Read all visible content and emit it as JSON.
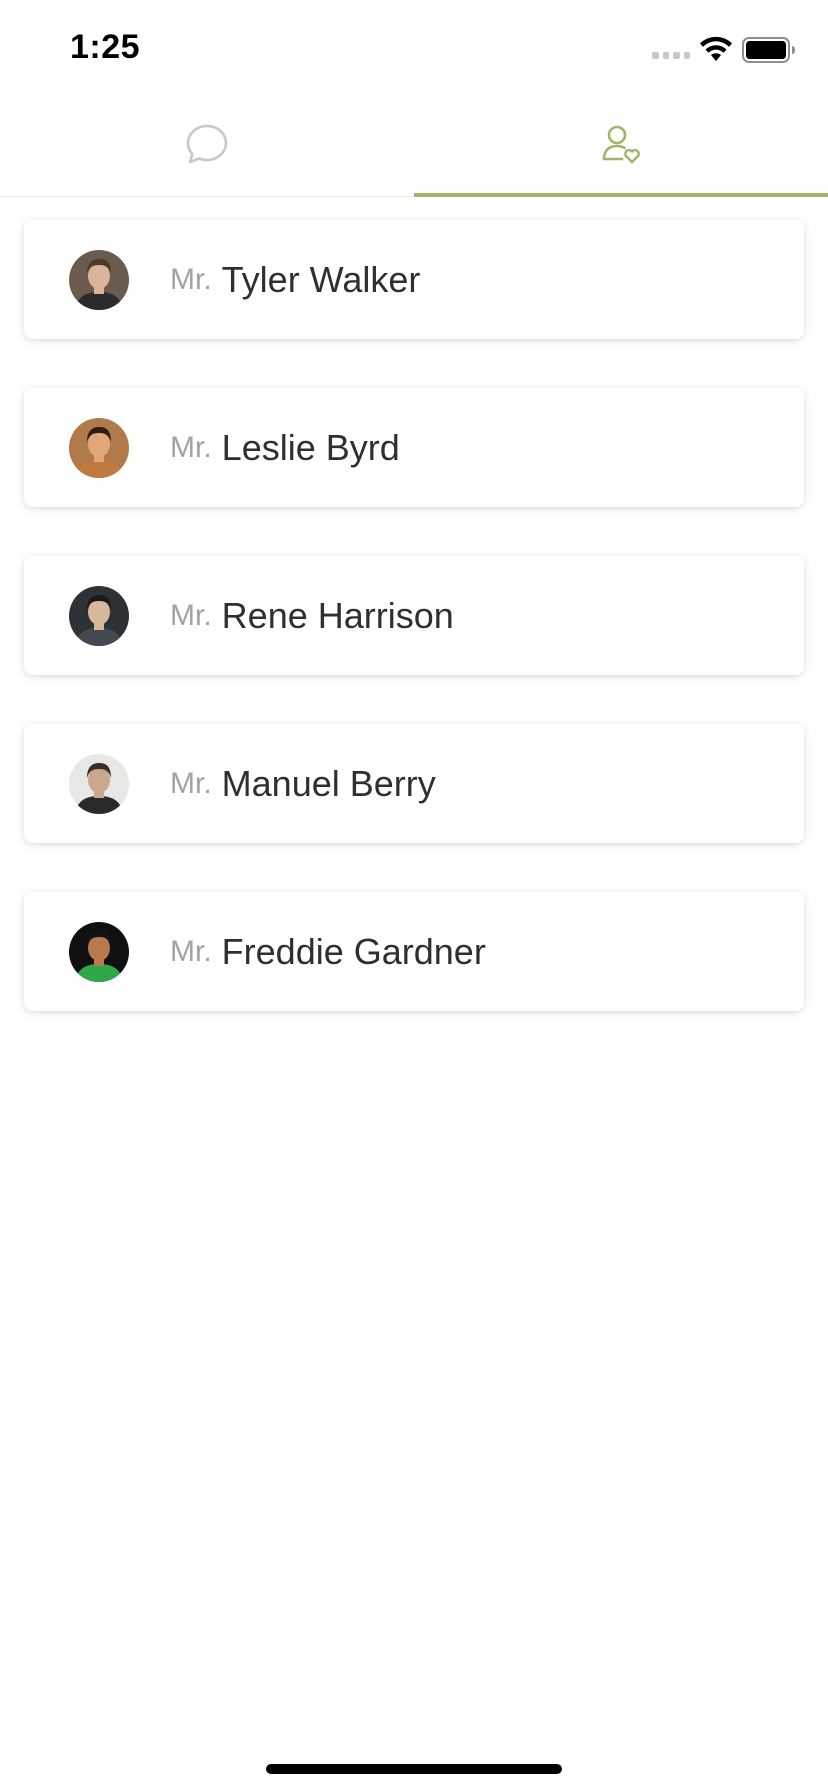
{
  "status_bar": {
    "time": "1:25"
  },
  "tabs": [
    {
      "icon": "chat-bubble-icon",
      "active": false
    },
    {
      "icon": "user-heart-icon",
      "active": true
    }
  ],
  "colors": {
    "accent": "#a0b46a",
    "inactive_icon": "#c7c7cc",
    "title_text": "#a3a3a3",
    "name_text": "#2f2f2f"
  },
  "contacts": [
    {
      "title": "Mr.",
      "name": "Tyler Walker",
      "avatar_bg": "#6b5b4e",
      "skin": "#d9b49a",
      "hair": "#4a3a2e",
      "shirt": "#2b2b2b"
    },
    {
      "title": "Mr.",
      "name": "Leslie Byrd",
      "avatar_bg": "#b07a4a",
      "skin": "#e0a878",
      "hair": "#2a1e16",
      "shirt": "#c07a3e"
    },
    {
      "title": "Mr.",
      "name": "Rene Harrison",
      "avatar_bg": "#2d3236",
      "skin": "#d8b89a",
      "hair": "#1a1a1a",
      "shirt": "#444a50"
    },
    {
      "title": "Mr.",
      "name": "Manuel Berry",
      "avatar_bg": "#e6e8e6",
      "skin": "#c9a88c",
      "hair": "#3a2f28",
      "shirt": "#2a2a2a"
    },
    {
      "title": "Mr.",
      "name": "Freddie Gardner",
      "avatar_bg": "#101010",
      "skin": "#b8794e",
      "hair": "#141414",
      "shirt": "#2fa84a"
    }
  ]
}
